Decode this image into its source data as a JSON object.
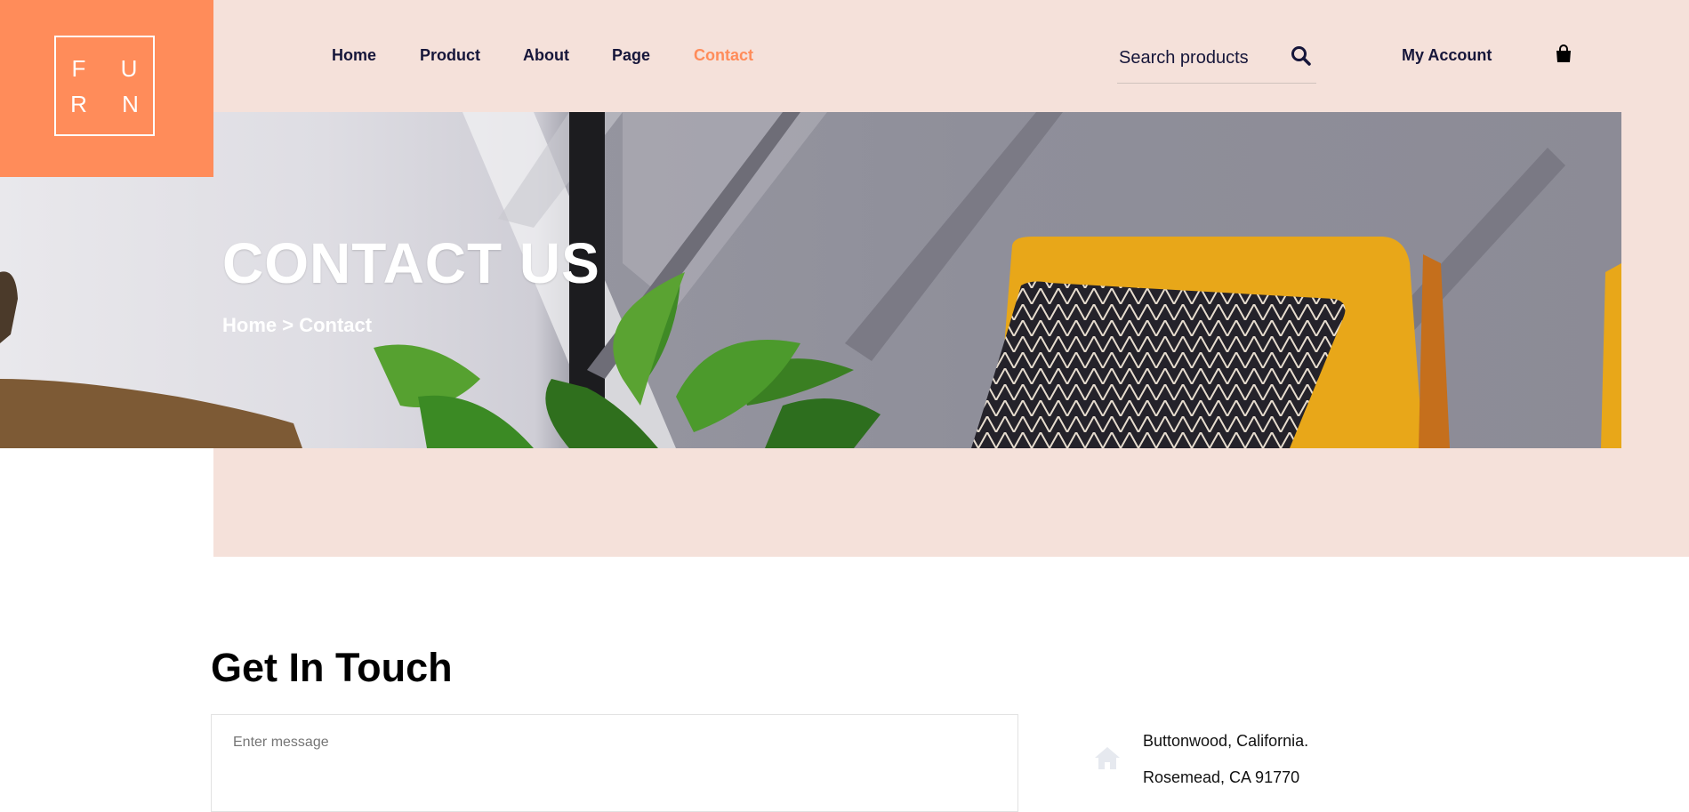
{
  "brand": {
    "logo_line1": "F U",
    "logo_line2": "R N",
    "accent": "#ff8c5a",
    "peach": "#f5e1da"
  },
  "nav": {
    "items": [
      {
        "label": "Home",
        "active": false
      },
      {
        "label": "Product",
        "active": false
      },
      {
        "label": "About",
        "active": false
      },
      {
        "label": "Page",
        "active": false
      },
      {
        "label": "Contact",
        "active": true
      }
    ],
    "search_placeholder": "Search products",
    "account_label": "My Account",
    "search_icon": "search-icon",
    "cart_icon": "shopping-bag-icon"
  },
  "hero": {
    "title": "CONTACT US",
    "breadcrumb": {
      "home": "Home",
      "separator": " > ",
      "current": "Contact"
    }
  },
  "contact": {
    "heading": "Get In Touch",
    "message_placeholder": "Enter message",
    "address_icon": "home-icon",
    "address_line1": "Buttonwood, California.",
    "address_line2": "Rosemead, CA 91770"
  }
}
